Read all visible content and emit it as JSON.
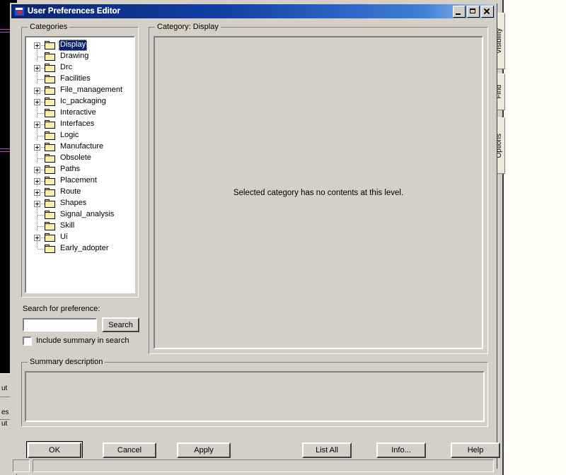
{
  "window": {
    "title": "User Preferences Editor",
    "icon": "app-icon",
    "minimize_label": "Minimize",
    "maximize_label": "Maximize",
    "close_label": "Close"
  },
  "categories_group": {
    "label": "Categories",
    "tree": [
      {
        "label": "Display",
        "expandable": true,
        "selected": true
      },
      {
        "label": "Drawing",
        "expandable": false,
        "selected": false
      },
      {
        "label": "Drc",
        "expandable": true,
        "selected": false
      },
      {
        "label": "Facilities",
        "expandable": false,
        "selected": false
      },
      {
        "label": "File_management",
        "expandable": true,
        "selected": false
      },
      {
        "label": "Ic_packaging",
        "expandable": true,
        "selected": false
      },
      {
        "label": "Interactive",
        "expandable": false,
        "selected": false
      },
      {
        "label": "Interfaces",
        "expandable": true,
        "selected": false
      },
      {
        "label": "Logic",
        "expandable": false,
        "selected": false
      },
      {
        "label": "Manufacture",
        "expandable": true,
        "selected": false
      },
      {
        "label": "Obsolete",
        "expandable": false,
        "selected": false
      },
      {
        "label": "Paths",
        "expandable": true,
        "selected": false
      },
      {
        "label": "Placement",
        "expandable": true,
        "selected": false
      },
      {
        "label": "Route",
        "expandable": true,
        "selected": false
      },
      {
        "label": "Shapes",
        "expandable": true,
        "selected": false
      },
      {
        "label": "Signal_analysis",
        "expandable": false,
        "selected": false
      },
      {
        "label": "Skill",
        "expandable": false,
        "selected": false
      },
      {
        "label": "Ui",
        "expandable": true,
        "selected": false
      },
      {
        "label": "Early_adopter",
        "expandable": false,
        "selected": false
      }
    ]
  },
  "category_group": {
    "label": "Category:   Display",
    "empty_message": "Selected category has no contents at this level."
  },
  "search": {
    "label": "Search for preference:",
    "value": "",
    "placeholder": "",
    "button_label": "Search",
    "include_summary_label": "Include summary in search",
    "include_summary_checked": false
  },
  "summary_group": {
    "label": "Summary description",
    "text": ""
  },
  "buttons": {
    "ok": "OK",
    "cancel": "Cancel",
    "apply": "Apply",
    "list_all": "List All",
    "info": "Info...",
    "help": "Help"
  },
  "side_tabs": [
    {
      "label": "Visibility"
    },
    {
      "label": "Find"
    },
    {
      "label": "Options"
    }
  ],
  "background_fragments": {
    "row1": "ut",
    "row2": "es",
    "row3": "ut"
  },
  "colors": {
    "face": "#d4d0c8",
    "title_start": "#0a246a",
    "title_end": "#a6c8ef",
    "selection": "#0a246a",
    "folder": "#f8f0a8",
    "desktop": "#000000",
    "page": "#fffff8"
  }
}
